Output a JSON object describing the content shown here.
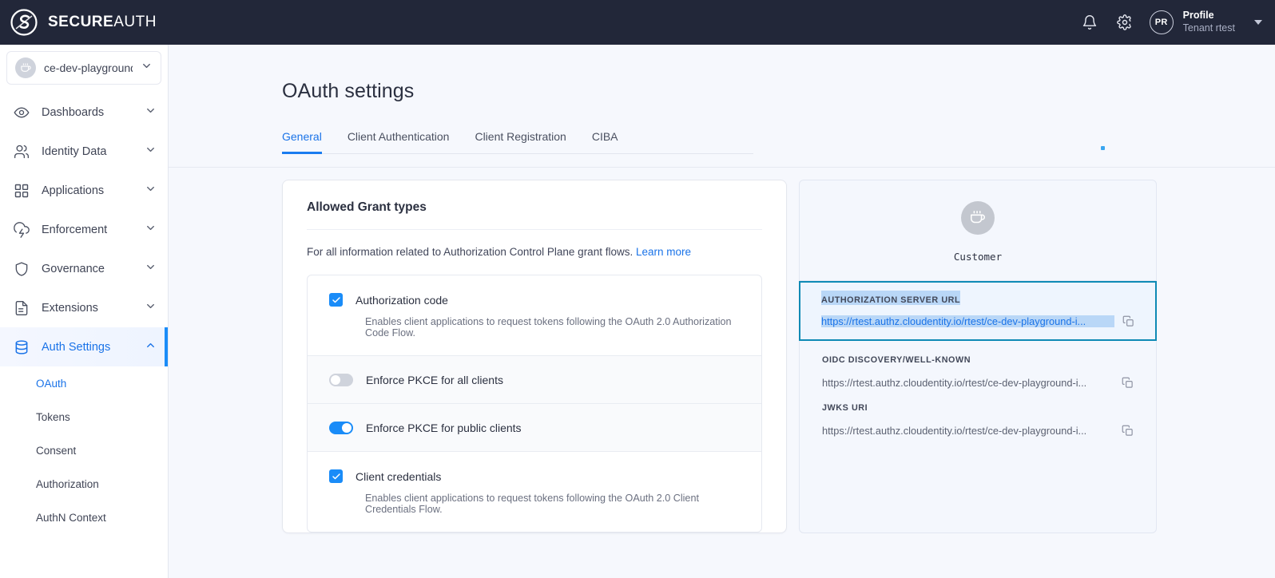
{
  "topbar": {
    "brand_bold": "SECURE",
    "brand_light": "AUTH",
    "logo_icon": "secureauth-logo-icon",
    "bell_icon": "notifications-bell-icon",
    "gear_icon": "settings-gear-icon",
    "avatar_initials": "PR",
    "profile_name": "Profile",
    "profile_tenant": "Tenant rtest",
    "caret_icon": "chevron-down-icon"
  },
  "sidebar": {
    "tenant": {
      "name": "ce-dev-playground-i...",
      "avatar_icon": "coffee-cup-icon",
      "chevron_icon": "chevron-down-icon"
    },
    "items": [
      {
        "label": "Dashboards",
        "icon": "eye-icon",
        "chevron": "chevron-down-icon",
        "active": false
      },
      {
        "label": "Identity Data",
        "icon": "users-icon",
        "chevron": "chevron-down-icon",
        "active": false
      },
      {
        "label": "Applications",
        "icon": "grid-icon",
        "chevron": "chevron-down-icon",
        "active": false
      },
      {
        "label": "Enforcement",
        "icon": "cloud-lightning-icon",
        "chevron": "chevron-down-icon",
        "active": false
      },
      {
        "label": "Governance",
        "icon": "shield-icon",
        "chevron": "chevron-down-icon",
        "active": false
      },
      {
        "label": "Extensions",
        "icon": "document-icon",
        "chevron": "chevron-down-icon",
        "active": false
      },
      {
        "label": "Auth Settings",
        "icon": "database-icon",
        "chevron": "chevron-up-icon",
        "active": true
      }
    ],
    "subitems": [
      {
        "label": "OAuth",
        "active": true
      },
      {
        "label": "Tokens",
        "active": false
      },
      {
        "label": "Consent",
        "active": false
      },
      {
        "label": "Authorization",
        "active": false
      },
      {
        "label": "AuthN Context",
        "active": false
      }
    ]
  },
  "main": {
    "page_title": "OAuth settings",
    "tabs": [
      {
        "label": "General",
        "active": true
      },
      {
        "label": "Client Authentication",
        "active": false
      },
      {
        "label": "Client Registration",
        "active": false
      },
      {
        "label": "CIBA",
        "active": false
      }
    ],
    "card": {
      "title": "Allowed Grant types",
      "subtitle_text": "For all information related to Authorization Control Plane grant flows.",
      "subtitle_link": "Learn more",
      "rows": [
        {
          "control": "checkbox",
          "checked": true,
          "label": "Authorization code",
          "description": "Enables client applications to request tokens following the OAuth 2.0 Authorization Code Flow.",
          "tinted": false
        },
        {
          "control": "toggle",
          "checked": false,
          "label": "Enforce PKCE for all clients",
          "description": "",
          "tinted": true
        },
        {
          "control": "toggle",
          "checked": true,
          "label": "Enforce PKCE for public clients",
          "description": "",
          "tinted": true
        },
        {
          "control": "checkbox",
          "checked": true,
          "label": "Client credentials",
          "description": "Enables client applications to request tokens following the OAuth 2.0 Client Credentials Flow.",
          "tinted": false
        }
      ]
    },
    "side_panel": {
      "avatar_icon": "coffee-cup-icon",
      "name": "Customer",
      "urls": [
        {
          "label": "AUTHORIZATION SERVER URL",
          "value": "https://rtest.authz.cloudentity.io/rtest/ce-dev-playground-i...",
          "copy_icon": "copy-icon",
          "selected": true
        },
        {
          "label": "OIDC DISCOVERY/WELL-KNOWN",
          "value": "https://rtest.authz.cloudentity.io/rtest/ce-dev-playground-i...",
          "copy_icon": "copy-icon",
          "selected": false
        },
        {
          "label": "JWKS URI",
          "value": "https://rtest.authz.cloudentity.io/rtest/ce-dev-playground-i...",
          "copy_icon": "copy-icon",
          "selected": false
        }
      ]
    }
  },
  "colors": {
    "topbar_bg": "#222739",
    "accent_blue": "#1a73e8",
    "toggle_on": "#1a8cf8",
    "page_bg": "#f6f8fd",
    "selection_border": "#0e8ab5",
    "selection_highlight": "#b9d7f7"
  }
}
